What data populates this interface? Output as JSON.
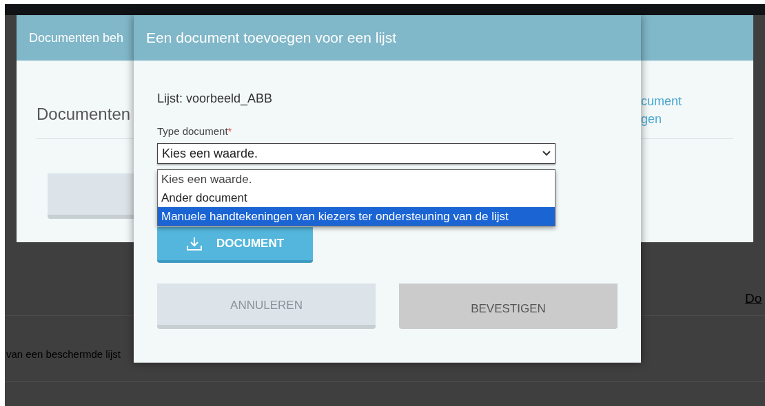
{
  "background_page": {
    "text": "van een beschermde lijst",
    "link": "Do"
  },
  "back_dialog": {
    "title": "Documenten beh",
    "heading": "Documenten",
    "link_lines": [
      "cument",
      "gen"
    ]
  },
  "dialog": {
    "title": "Een document toevoegen voor een lijst",
    "list_label": "Lijst: voorbeeld_ABB",
    "field": {
      "label": "Type document",
      "required": true,
      "required_mark": "*",
      "value": "Kies een waarde.",
      "expanded": true,
      "options": [
        {
          "label": "Kies een waarde.",
          "selected": true,
          "highlighted": false
        },
        {
          "label": "Ander document",
          "selected": false,
          "highlighted": false
        },
        {
          "label": "Manuele handtekeningen van kiezers ter ondersteuning van de lijst",
          "selected": false,
          "highlighted": true
        }
      ]
    },
    "upload_button": "DOCUMENT",
    "buttons": [
      {
        "label": "ANNULEREN",
        "kind": "cancel"
      },
      {
        "label": "BEVESTIGEN",
        "kind": "confirm"
      }
    ]
  }
}
